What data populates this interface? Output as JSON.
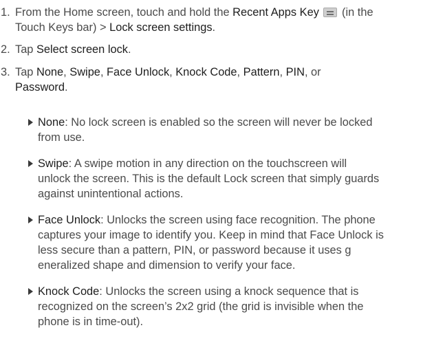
{
  "steps": [
    {
      "number": "1.",
      "line1_a": "From the Home screen, touch and hold the ",
      "recent_apps_key": "Recent Apps Key",
      "line1_b": " (in the",
      "line2_a": "Touch Keys bar) > ",
      "lock_screen_settings": "Lock screen settings",
      "line2_b": "."
    },
    {
      "number": "2.",
      "text_a": "Tap ",
      "select_screen_lock": "Select screen lock",
      "text_b": "."
    },
    {
      "number": "3.",
      "text_tap": "Tap ",
      "opt_none": "None",
      "sep1": ", ",
      "opt_swipe": "Swipe",
      "sep2": ", ",
      "opt_face": "Face Unlock",
      "sep3": ", ",
      "opt_knock": "Knock Code",
      "sep4": ", ",
      "opt_pattern": "Pattern",
      "sep5": ", ",
      "opt_pin": "PIN",
      "sep6": ", or",
      "opt_password": "Password",
      "end": "."
    }
  ],
  "bullets": [
    {
      "term": "None",
      "lines": [
        ": No lock screen is enabled so the screen will never be locked",
        "from use."
      ]
    },
    {
      "term": "Swipe",
      "lines": [
        ": A swipe motion in any direction on the touchscreen will",
        "unlock the screen. This is the default Lock screen that simply guards",
        "against unintentional actions."
      ]
    },
    {
      "term": "Face Unlock",
      "lines": [
        ": Unlocks the screen using face recognition. The phone",
        "captures your image to identify you. Keep in mind that Face Unlock is",
        "less secure than a pattern, PIN, or password because it uses g",
        "eneralized shape and dimension to verify your face."
      ]
    },
    {
      "term": "Knock Code",
      "lines": [
        ": Unlocks the screen using a knock sequence that is",
        "recognized on the screen’s 2x2 grid (the grid is invisible when the",
        "phone is in time-out)."
      ]
    }
  ],
  "icons": {
    "recent_apps_key": "recent-apps-key-icon"
  }
}
